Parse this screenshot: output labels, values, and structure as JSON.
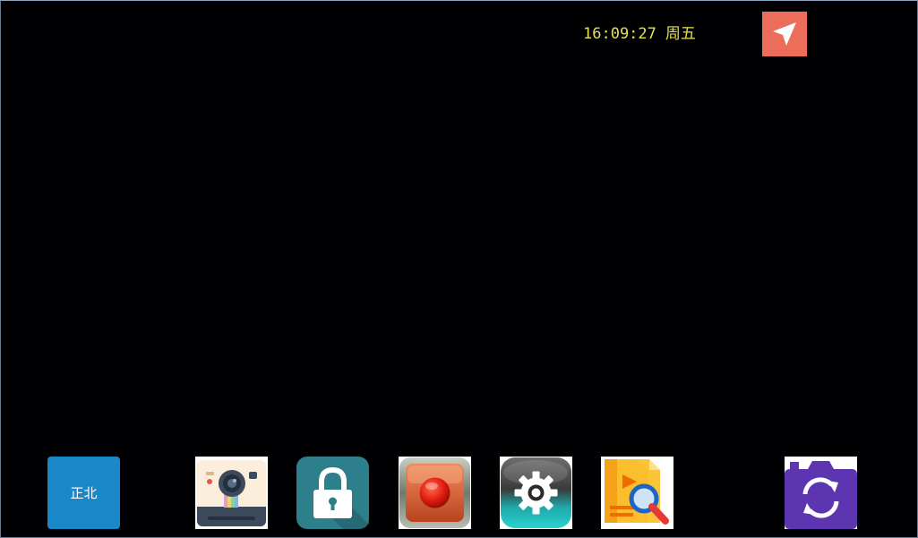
{
  "status_bar": {
    "time": "16:09:27",
    "weekday": "周五"
  },
  "compass": {
    "direction_label": "正北"
  },
  "icons": {
    "navigation": "navigation-arrow-icon",
    "camera": "polaroid-camera-icon",
    "lock": "padlock-icon",
    "record": "record-button-icon",
    "settings": "gear-icon",
    "file_search": "video-file-search-icon",
    "switch_camera": "switch-camera-icon"
  },
  "colors": {
    "clock_text": "#e6e24a",
    "nav_button": "#ec6e5a",
    "north_button": "#1a87c9",
    "switch_camera": "#5e35b1"
  }
}
